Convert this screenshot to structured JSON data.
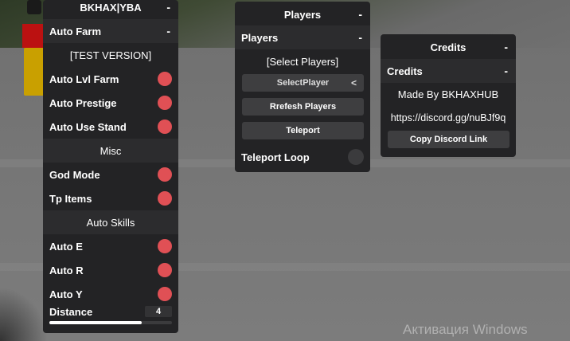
{
  "main_panel": {
    "title": "BKHAX|YBA",
    "title_dash": "-",
    "section": "Auto Farm",
    "section_dash": "-",
    "test_version": "[TEST VERSION]",
    "toggles_farm": [
      {
        "label": "Auto Lvl Farm",
        "state": "on"
      },
      {
        "label": "Auto Prestige",
        "state": "on"
      },
      {
        "label": "Auto Use Stand",
        "state": "on"
      }
    ],
    "misc_header": "Misc",
    "toggles_misc": [
      {
        "label": "God Mode",
        "state": "on"
      },
      {
        "label": "Tp Items",
        "state": "on"
      }
    ],
    "skills_header": "Auto Skills",
    "toggles_skills": [
      {
        "label": "Auto E",
        "state": "on"
      },
      {
        "label": "Auto R",
        "state": "on"
      },
      {
        "label": "Auto Y",
        "state": "on"
      }
    ],
    "distance": {
      "label": "Distance",
      "value": "4",
      "fill_fraction": 0.75
    }
  },
  "players_panel": {
    "title": "Players",
    "title_dash": "-",
    "section": "Players",
    "section_dash": "-",
    "select_header": "[Select Players]",
    "select_button": "SelectPlayer",
    "select_arrow": "<",
    "refresh_button": "Rrefesh Players",
    "teleport_button": "Teleport",
    "teleport_loop": {
      "label": "Teleport Loop",
      "state": "off"
    }
  },
  "credits_panel": {
    "title": "Credits",
    "title_dash": "-",
    "section": "Credits",
    "section_dash": "-",
    "made_by": "Made By BKHAXHUB",
    "discord_url": "https://discord.gg/nuBJf9q",
    "copy_button": "Copy Discord Link"
  },
  "watermark": "Активация Windows",
  "colors": {
    "toggle_on": "#e05055",
    "toggle_off": "#3b3b3d",
    "panel_bg": "#232325"
  }
}
